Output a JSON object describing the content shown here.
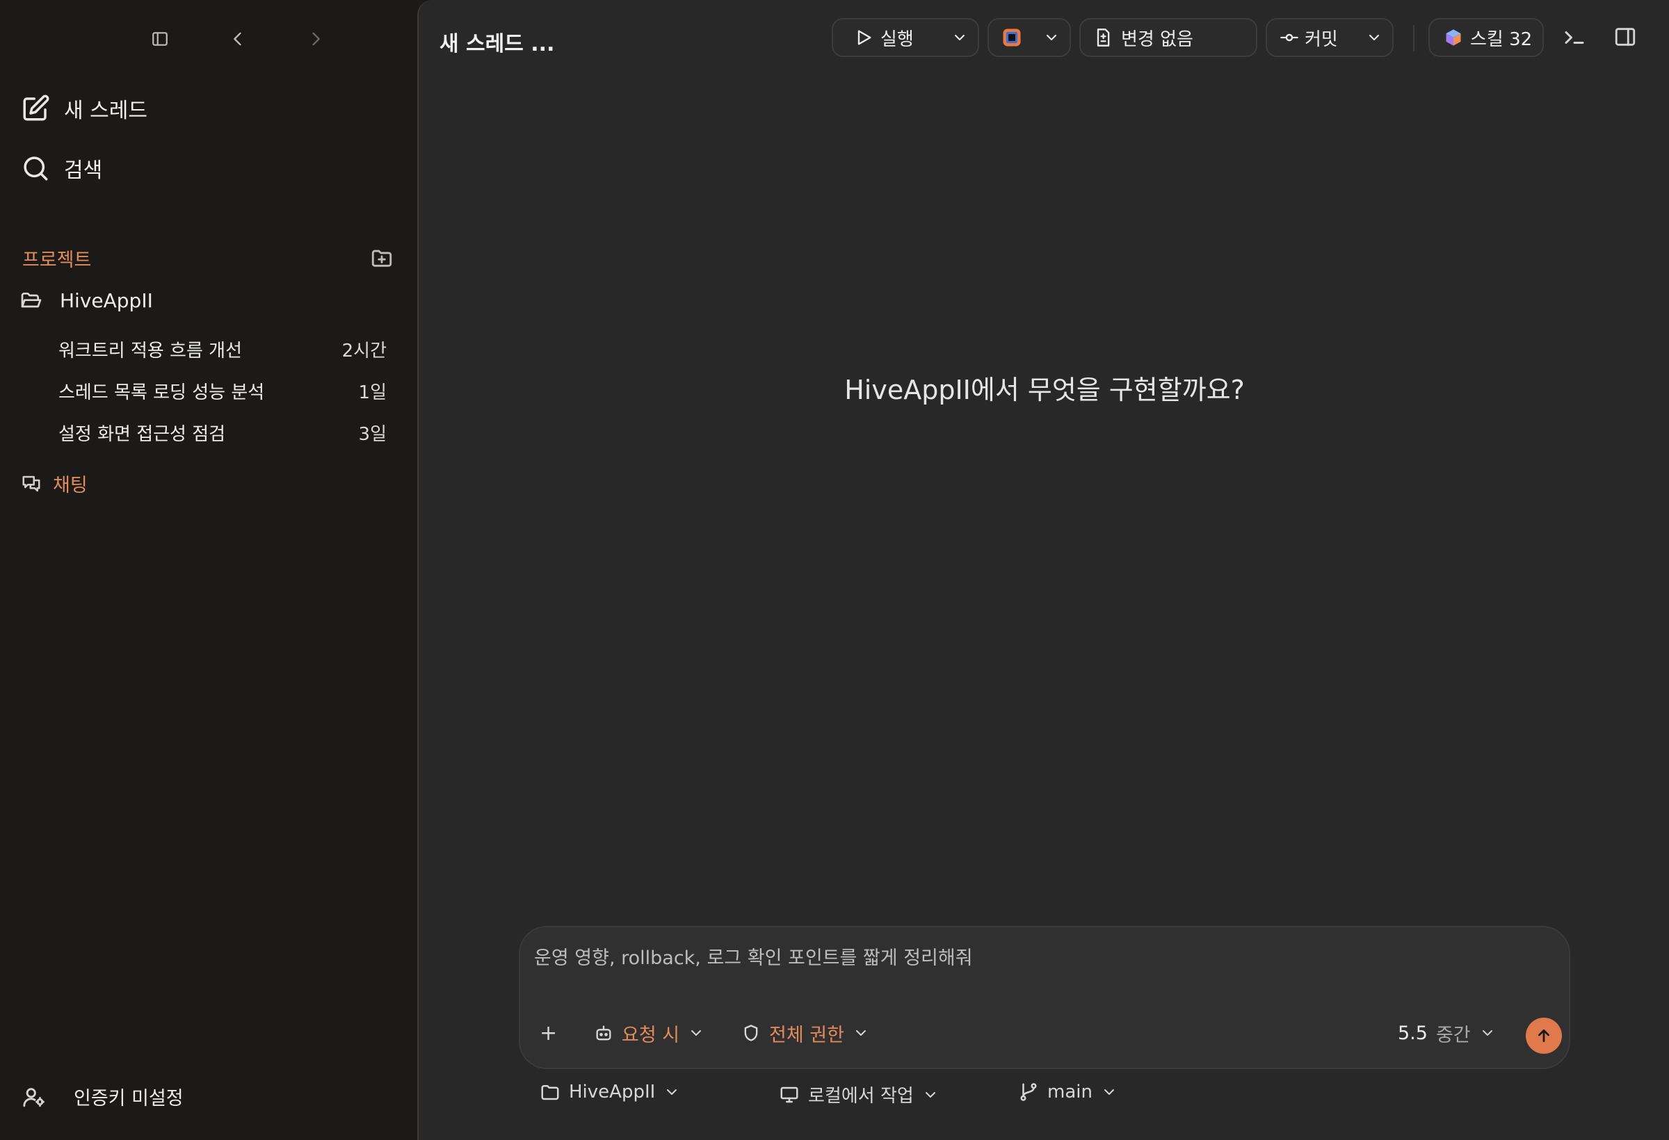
{
  "sidebar": {
    "new_thread_label": "새 스레드",
    "search_label": "검색",
    "projects_label": "프로젝트",
    "project": {
      "name": "HiveAppII",
      "threads": [
        {
          "title": "워크트리 적용 흐름 개선",
          "time": "2시간"
        },
        {
          "title": "스레드 목록 로딩 성능 분석",
          "time": "1일"
        },
        {
          "title": "설정 화면 접근성 점검",
          "time": "3일"
        }
      ]
    },
    "chat_label": "채팅",
    "auth_label": "인증키 미설정"
  },
  "header": {
    "thread_title": "새 스레드 ...",
    "run_label": "실행",
    "changes_label": "변경 없음",
    "commit_label": "커밋",
    "skills_label": "스킬 32"
  },
  "main": {
    "hero_text": "HiveAppII에서 무엇을 구현할까요?"
  },
  "composer": {
    "placeholder": "운영 영향, rollback, 로그 확인 포인트를 짧게 정리해줘",
    "plus_label": "+",
    "mode_label": "요청 시",
    "permission_label": "전체 권한",
    "model_version": "5.5",
    "model_effort": "중간"
  },
  "footer": {
    "project_label": "HiveAppII",
    "env_label": "로컬에서 작업",
    "branch_label": "main"
  },
  "colors": {
    "accent": "#e38a5a",
    "send_button": "#e07a4c",
    "sidebar_bg": "#1b1a19",
    "main_bg": "#282828"
  }
}
